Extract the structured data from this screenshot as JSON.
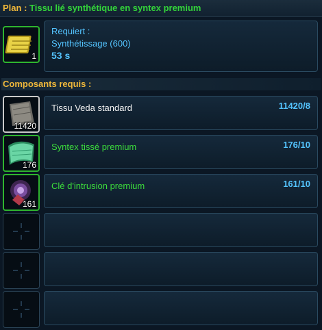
{
  "header": {
    "plan_label": "Plan :",
    "plan_name": "Tissu lié synthétique en syntex premium"
  },
  "schematic": {
    "icon": "folded-yellow-cloth-icon",
    "quantity": "1",
    "requires_label": "Requiert :",
    "skill": "Synthétissage (600)",
    "time": "53 s"
  },
  "components": {
    "title": "Composants requis :",
    "items": [
      {
        "icon": "grey-cloth-icon",
        "quantity": "11420",
        "name": "Tissu Veda standard",
        "have": "11420",
        "sep": "/",
        "need": "8",
        "quality": "standard"
      },
      {
        "icon": "green-fabric-roll-icon",
        "quantity": "176",
        "name": "Syntex tissé premium",
        "have": "176",
        "sep": "/",
        "need": "10",
        "quality": "premium"
      },
      {
        "icon": "purple-intrusion-key-icon",
        "quantity": "161",
        "name": "Clé d'intrusion premium",
        "have": "161",
        "sep": "/",
        "need": "10",
        "quality": "premium"
      }
    ],
    "empty_slots": 3
  },
  "colors": {
    "gold": "#f0b83a",
    "green": "#3cdc3c",
    "blue": "#54c4ff",
    "white": "#f2f2f2"
  }
}
